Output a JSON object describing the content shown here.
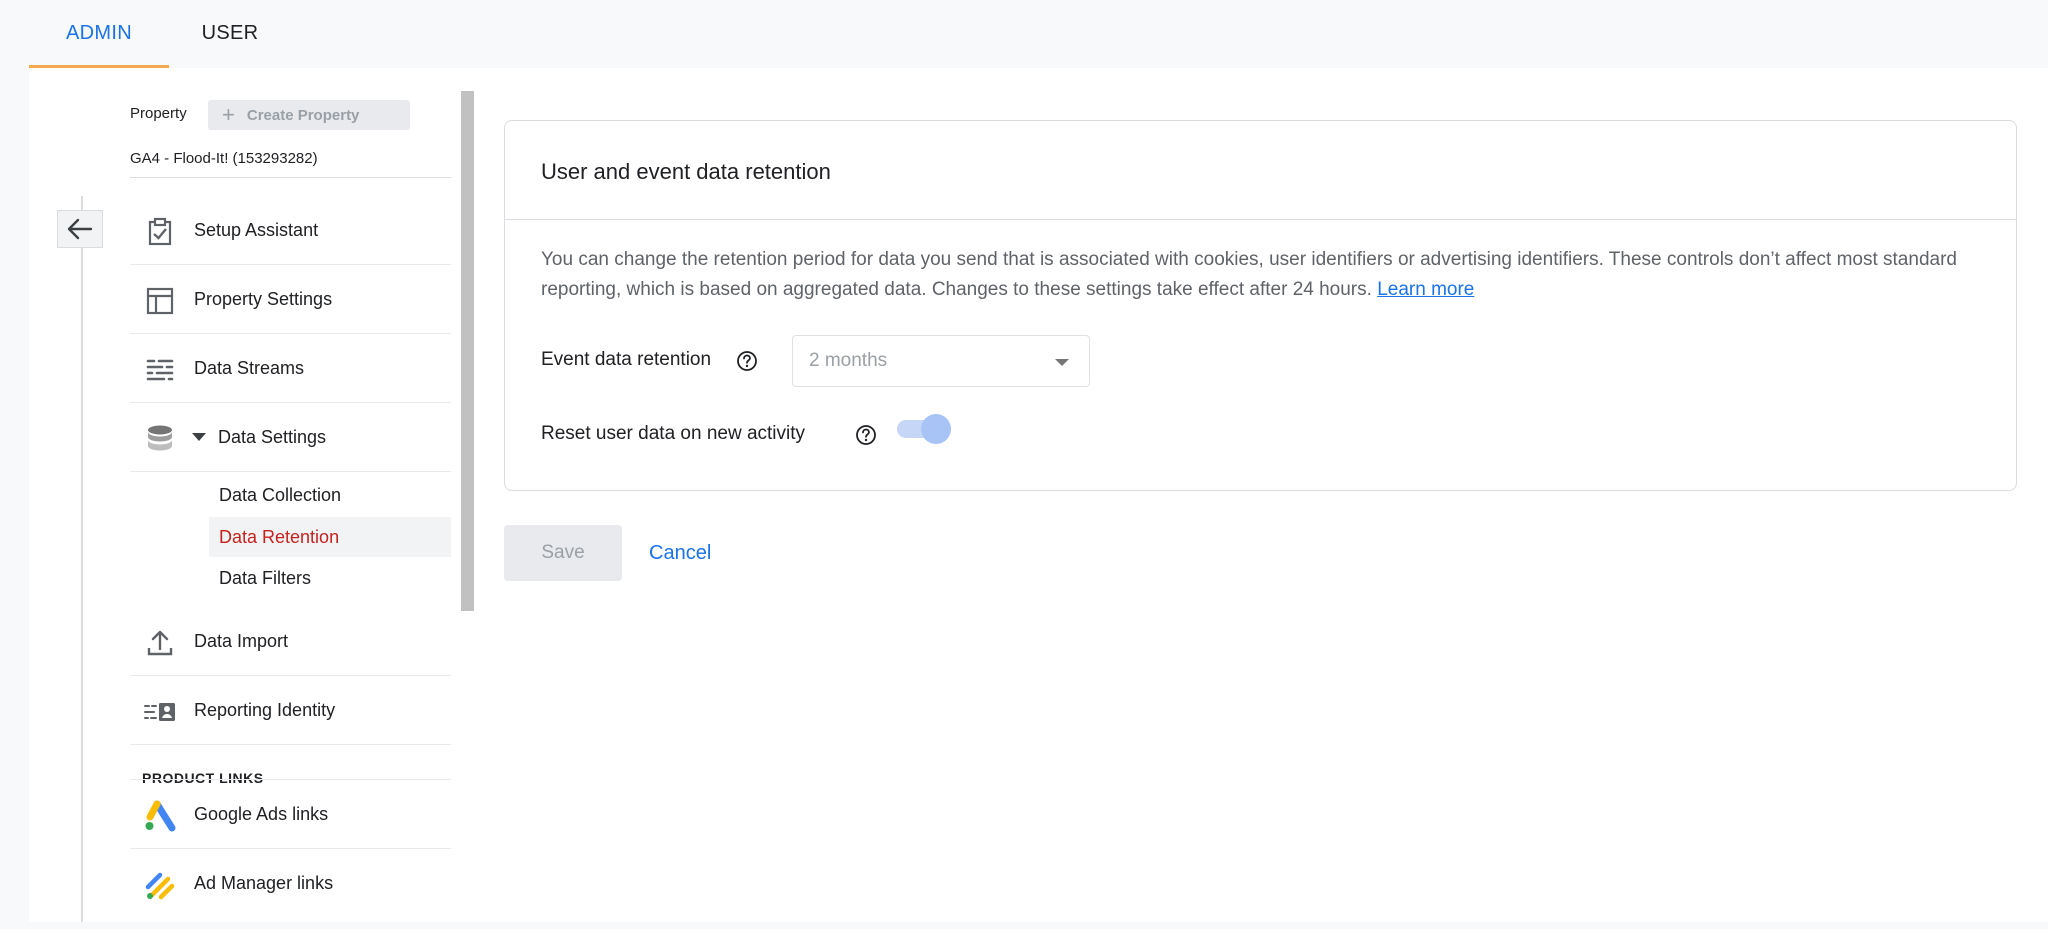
{
  "tabs": [
    {
      "label": "ADMIN",
      "active": true
    },
    {
      "label": "USER",
      "active": false
    }
  ],
  "property": {
    "label": "Property",
    "create_label": "Create Property",
    "name": "GA4 - Flood-It! (153293282)"
  },
  "nav": {
    "items": [
      {
        "label": "Setup Assistant",
        "icon": "clipboard-check-icon"
      },
      {
        "label": "Property Settings",
        "icon": "layout-icon"
      },
      {
        "label": "Data Streams",
        "icon": "streams-icon"
      },
      {
        "label": "Data Settings",
        "icon": "database-icon"
      },
      {
        "label": "Data Import",
        "icon": "upload-icon"
      },
      {
        "label": "Reporting Identity",
        "icon": "identity-icon"
      }
    ],
    "sub_items": [
      {
        "label": "Data Collection",
        "active": false
      },
      {
        "label": "Data Retention",
        "active": true
      },
      {
        "label": "Data Filters",
        "active": false
      }
    ],
    "section_heading": "PRODUCT LINKS",
    "links": [
      {
        "label": "Google Ads links",
        "icon": "google-ads-icon"
      },
      {
        "label": "Ad Manager links",
        "icon": "ad-manager-icon"
      }
    ]
  },
  "card": {
    "title": "User and event data retention",
    "description": "You can change the retention period for data you send that is associated with cookies, user identifiers or advertising identifiers. These controls don’t affect most standard reporting, which is based on aggregated data. Changes to these settings take effect after 24 hours.",
    "learn_more": "Learn more",
    "event_retention_label": "Event data retention",
    "event_retention_value": "2 months",
    "reset_label": "Reset user data on new activity",
    "reset_enabled": true
  },
  "actions": {
    "save": "Save",
    "cancel": "Cancel"
  },
  "colors": {
    "accent": "#1a73e8",
    "active_nav": "#c5221f",
    "tab_underline": "#f4a94e"
  }
}
